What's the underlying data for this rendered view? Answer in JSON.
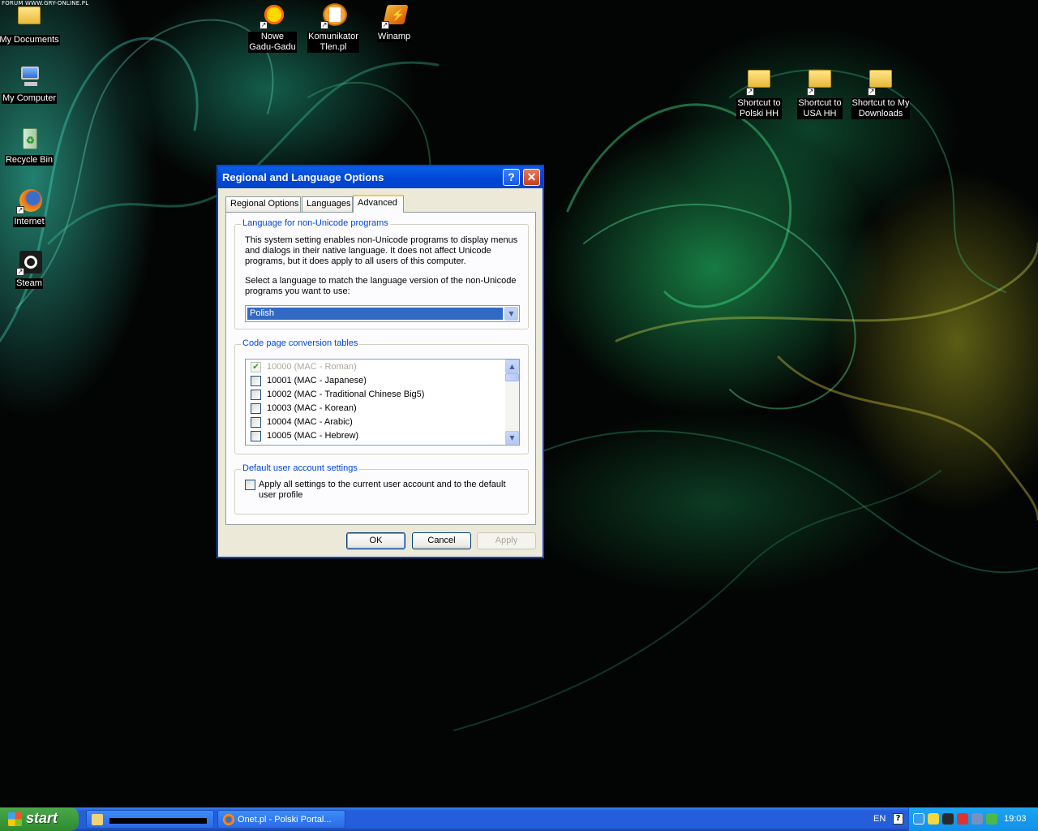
{
  "watermark": "FORUM WWW.GRY-ONLINE.PL",
  "desktop_icons_left": [
    {
      "label": "My Documents",
      "icon": "my-documents-icon"
    },
    {
      "label": "My Computer",
      "icon": "my-computer-icon"
    },
    {
      "label": "Recycle Bin",
      "icon": "recycle-bin-icon"
    },
    {
      "label": "Internet",
      "icon": "firefox-icon"
    },
    {
      "label": "Steam",
      "icon": "steam-icon"
    }
  ],
  "desktop_icons_top": [
    {
      "label_line1": "Nowe",
      "label_line2": "Gadu-Gadu",
      "icon": "gadu-gadu-icon"
    },
    {
      "label_line1": "Komunikator",
      "label_line2": "Tlen.pl",
      "icon": "tlen-icon"
    },
    {
      "label_line1": "Winamp",
      "label_line2": "",
      "icon": "winamp-icon"
    }
  ],
  "desktop_icons_right": [
    {
      "label_line1": "Shortcut to",
      "label_line2": "Polski HH",
      "icon": "folder-icon"
    },
    {
      "label_line1": "Shortcut to",
      "label_line2": "USA HH",
      "icon": "folder-icon"
    },
    {
      "label_line1": "Shortcut to My",
      "label_line2": "Downloads",
      "icon": "folder-icon"
    }
  ],
  "dialog": {
    "title": "Regional and Language Options",
    "help_glyph": "?",
    "close_glyph": "✕",
    "tabs": [
      "Regional Options",
      "Languages",
      "Advanced"
    ],
    "active_tab": "Advanced",
    "nonunicode": {
      "title": "Language for non-Unicode programs",
      "desc_lines": [
        "This system setting enables non-Unicode programs to display menus",
        "and dialogs in their native language. It does not affect Unicode",
        "programs, but it does apply to all users of this computer."
      ],
      "select_lines": [
        "Select a language to match the language version of the non-Unicode",
        "programs you want to use:"
      ],
      "selected_language": "Polish"
    },
    "codepage": {
      "title": "Code page conversion tables",
      "items": [
        {
          "label": "10000 (MAC - Roman)",
          "checked": true,
          "disabled": true
        },
        {
          "label": "10001 (MAC - Japanese)",
          "checked": false,
          "disabled": false
        },
        {
          "label": "10002 (MAC - Traditional Chinese Big5)",
          "checked": false,
          "disabled": false
        },
        {
          "label": "10003 (MAC - Korean)",
          "checked": false,
          "disabled": false
        },
        {
          "label": "10004 (MAC - Arabic)",
          "checked": false,
          "disabled": false
        },
        {
          "label": "10005 (MAC - Hebrew)",
          "checked": false,
          "disabled": false
        }
      ]
    },
    "default_user": {
      "title": "Default user account settings",
      "checkbox_line1": "Apply all settings to the current user account and to the default",
      "checkbox_line2": "user profile",
      "checked": false
    },
    "buttons": {
      "ok": "OK",
      "cancel": "Cancel",
      "apply": "Apply"
    }
  },
  "taskbar": {
    "start_label": "start",
    "tasks": [
      {
        "label": "",
        "icon": "folder-icon",
        "redacted": true
      },
      {
        "label": "Onet.pl - Polski Portal...",
        "icon": "firefox-icon"
      }
    ],
    "language": "EN",
    "help_glyph": "?",
    "clock": "19:03"
  },
  "colors": {
    "xp_blue": "#0054e3",
    "taskbar_blue": "#245edb",
    "start_green": "#3c9a3c",
    "group_title_blue": "#0046d5",
    "selection_blue": "#316ac5"
  }
}
